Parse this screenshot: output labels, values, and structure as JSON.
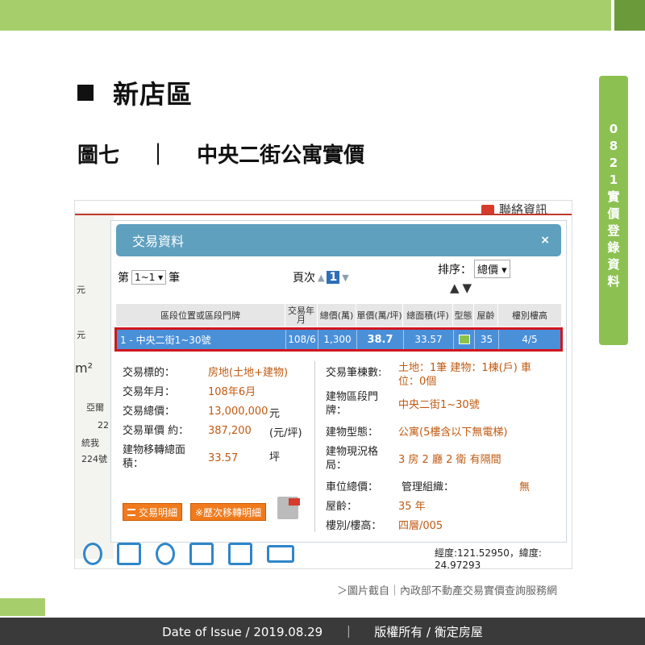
{
  "side_tab": [
    "0",
    "8",
    "2",
    "1",
    "實",
    "價",
    "登",
    "錄",
    "資",
    "料"
  ],
  "heading": "新店區",
  "subtitle": "圖七　 ｜　 中央二街公寓實價",
  "map": {
    "contact": "聯絡資訊",
    "unit_m2": "m²",
    "labels": [
      "元",
      "元",
      "亞爾",
      "22",
      "統我",
      "224號"
    ]
  },
  "dialog": {
    "title": "交易資料",
    "close": "×",
    "pager_prefix": "第",
    "pager_select": "1~1 ▾",
    "pager_suffix": "筆",
    "page_label": "頁次",
    "page_current": "1",
    "sort_label": "排序：",
    "sort_select": "總價 ▾",
    "sort_arrows": "▲▼",
    "columns": [
      "區段位置或區段門牌",
      "交易年月",
      "總價(萬)",
      "單價(萬/坪)",
      "總面積(坪)",
      "型態",
      "屋齡",
      "樓別樓高"
    ],
    "row": {
      "loc": "1 - 中央二街1~30號",
      "ym": "108/6",
      "total": "1,300",
      "unit": "38.7",
      "area": "33.57",
      "age": "35",
      "floor": "4/5"
    },
    "left_fields": {
      "target_label": "交易標的：",
      "target_value": "房地(土地+建物)",
      "ym_label": "交易年月：",
      "ym_value": "108年6月",
      "total_label": "交易總價：",
      "total_value": "13,000,000",
      "total_unit": "元",
      "unitp_label": "交易單價 約：",
      "unitp_value": "387,200",
      "unitp_unit": "(元/坪)",
      "area_label": "建物移轉總面積：",
      "area_value": "33.57",
      "area_unit": "坪"
    },
    "right_fields": {
      "count_label": "交易筆棟數:",
      "count_value": "土地：1筆 建物：1棟(戶) 車位：0個",
      "addr_label": "建物區段門牌：",
      "addr_value": "中央二街1~30號",
      "type_label": "建物型態：",
      "type_value": "公寓(5樓含以下無電梯)",
      "layout_label": "建物現況格局：",
      "layout_value": "3 房 2 廳 2 衛 有隔間",
      "park_label": "車位總價：",
      "mgmt_label": "管理組織：",
      "mgmt_value": "無",
      "age_label": "屋齡：",
      "age_value": "35 年",
      "floor_label": "樓別/樓高：",
      "floor_value": "四層/005"
    },
    "btn_detail": "交易明細",
    "btn_history": "※歷次移轉明細"
  },
  "coordinates": "經度:121.52950，緯度: 24.97293",
  "caption": "＞圖片截自｜內政部不動產交易實價查詢服務網",
  "footer": "Date of Issue / 2019.08.29　  ｜　  版權所有 / 衡定房屋",
  "colors": {
    "accent_green": "#a6cf6b",
    "side_green": "#8cc152",
    "dialog_blue": "#5fa0bf",
    "row_blue": "#4a90d9",
    "highlight_red": "#d0161e",
    "value_orange": "#c05a12"
  }
}
